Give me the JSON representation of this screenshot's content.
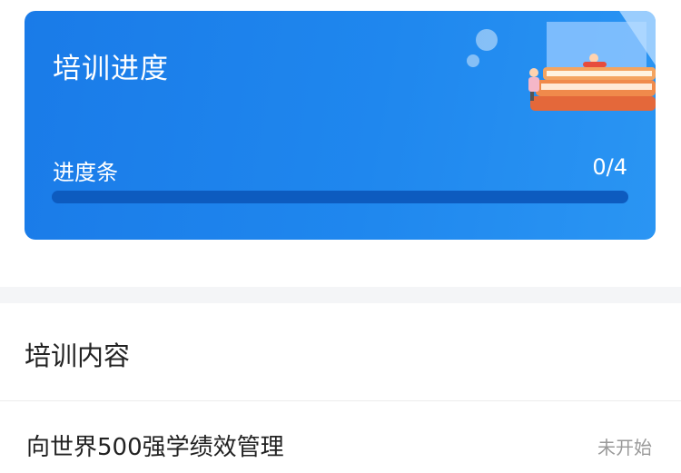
{
  "progress_card": {
    "title": "培训进度",
    "bar_label": "进度条",
    "count_text": "0/4",
    "progress_fraction": 0
  },
  "content_section": {
    "header": "培训内容",
    "courses": [
      {
        "title": "向世界500强学绩效管理",
        "status": "未开始"
      }
    ]
  },
  "colors": {
    "card_blue": "#1f87ee",
    "bar_track": "#0d5bbf",
    "status_gray": "#9a9a9a"
  }
}
